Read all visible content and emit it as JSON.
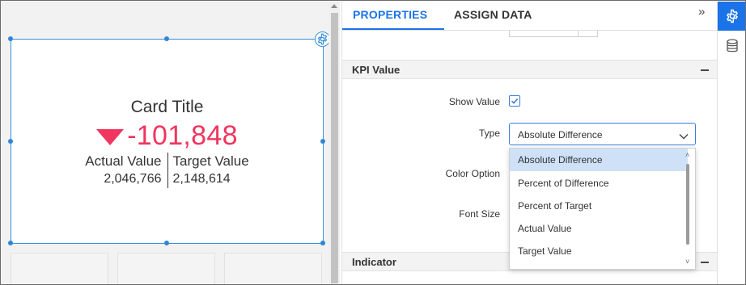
{
  "card": {
    "title": "Card Title",
    "kpi_value": "-101,848",
    "actual_label": "Actual Value",
    "actual_value": "2,046,766",
    "target_label": "Target Value",
    "target_value": "2,148,614"
  },
  "tabs": {
    "properties": "PROPERTIES",
    "assign_data": "ASSIGN DATA",
    "collapse": "»"
  },
  "sections": {
    "kpi_value": "KPI Value",
    "indicator": "Indicator"
  },
  "fields": {
    "show_value_label": "Show Value",
    "show_value_checked": true,
    "type_label": "Type",
    "type_value": "Absolute Difference",
    "color_option_label": "Color Option",
    "font_size_label": "Font Size"
  },
  "type_options": [
    "Absolute Difference",
    "Percent of Difference",
    "Percent of Target",
    "Actual Value",
    "Target Value"
  ],
  "colors": {
    "accent": "#1a73e8",
    "negative": "#f0355f",
    "selection": "#cfe1f7"
  },
  "rail": {
    "items": [
      "gear-icon",
      "database-icon"
    ]
  }
}
